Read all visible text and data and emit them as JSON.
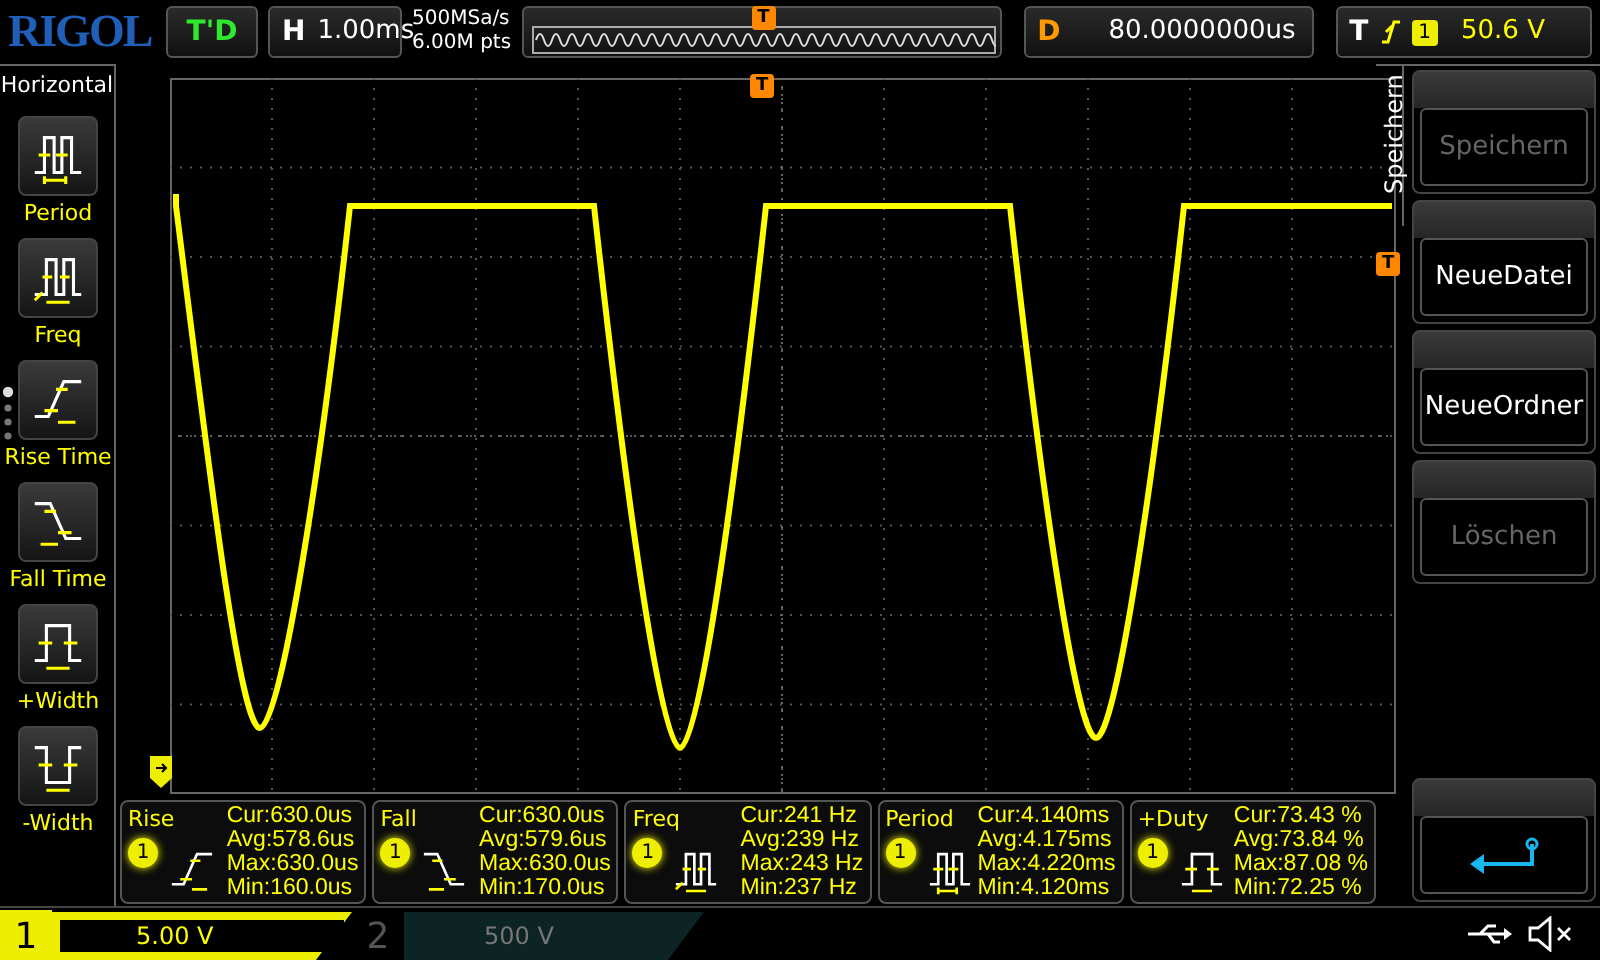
{
  "brand": "RIGOL",
  "run_status": "T'D",
  "horizontal": {
    "label": "H",
    "timebase": "1.00ms"
  },
  "acquisition": {
    "sample_rate": "500MSa/s",
    "memory_depth": "6.00M pts",
    "overview_marker": "T"
  },
  "delay": {
    "label": "D",
    "value": "80.0000000us"
  },
  "trigger": {
    "label": "T",
    "channel": "1",
    "level": "50.6 V"
  },
  "sidebar": {
    "title": "Horizontal",
    "items": [
      {
        "label": "Period",
        "kind": "period"
      },
      {
        "label": "Freq",
        "kind": "freq"
      },
      {
        "label": "Rise Time",
        "kind": "rise"
      },
      {
        "label": "Fall Time",
        "kind": "fall"
      },
      {
        "label": "+Width",
        "kind": "pwidth"
      },
      {
        "label": "-Width",
        "kind": "nwidth"
      }
    ]
  },
  "grid": {
    "trigger_position_marker": "T",
    "trigger_level_marker": "T"
  },
  "menu": {
    "title": "Speichern",
    "buttons": [
      {
        "kind": "text",
        "label": "Speichern",
        "disabled": true
      },
      {
        "kind": "text",
        "label": "NeueDatei",
        "disabled": false
      },
      {
        "kind": "text",
        "label": "NeueOrdner",
        "disabled": false
      },
      {
        "kind": "text",
        "label": "Löschen",
        "disabled": true
      },
      {
        "kind": "spacer"
      },
      {
        "kind": "back",
        "disabled": false
      }
    ]
  },
  "measurements": [
    {
      "name": "Rise",
      "channel": "1",
      "kind": "rise",
      "lines": [
        "Cur:630.0us",
        "Avg:578.6us",
        "Max:630.0us",
        "Min:160.0us"
      ]
    },
    {
      "name": "Fall",
      "channel": "1",
      "kind": "fall",
      "lines": [
        "Cur:630.0us",
        "Avg:579.6us",
        "Max:630.0us",
        "Min:170.0us"
      ]
    },
    {
      "name": "Freq",
      "channel": "1",
      "kind": "freq",
      "lines": [
        "Cur:241 Hz",
        "Avg:239 Hz",
        "Max:243 Hz",
        "Min:237 Hz"
      ]
    },
    {
      "name": "Period",
      "channel": "1",
      "kind": "period",
      "lines": [
        "Cur:4.140ms",
        "Avg:4.175ms",
        "Max:4.220ms",
        "Min:4.120ms"
      ]
    },
    {
      "name": "+Duty",
      "channel": "1",
      "kind": "pwidth",
      "lines": [
        "Cur:73.43 %",
        "Avg:73.84 %",
        "Max:87.08 %",
        "Min:72.25 %"
      ]
    }
  ],
  "channels": [
    {
      "number": "1",
      "scale": "5.00 V",
      "on": true
    },
    {
      "number": "2",
      "scale": "500 V",
      "on": false
    }
  ]
}
